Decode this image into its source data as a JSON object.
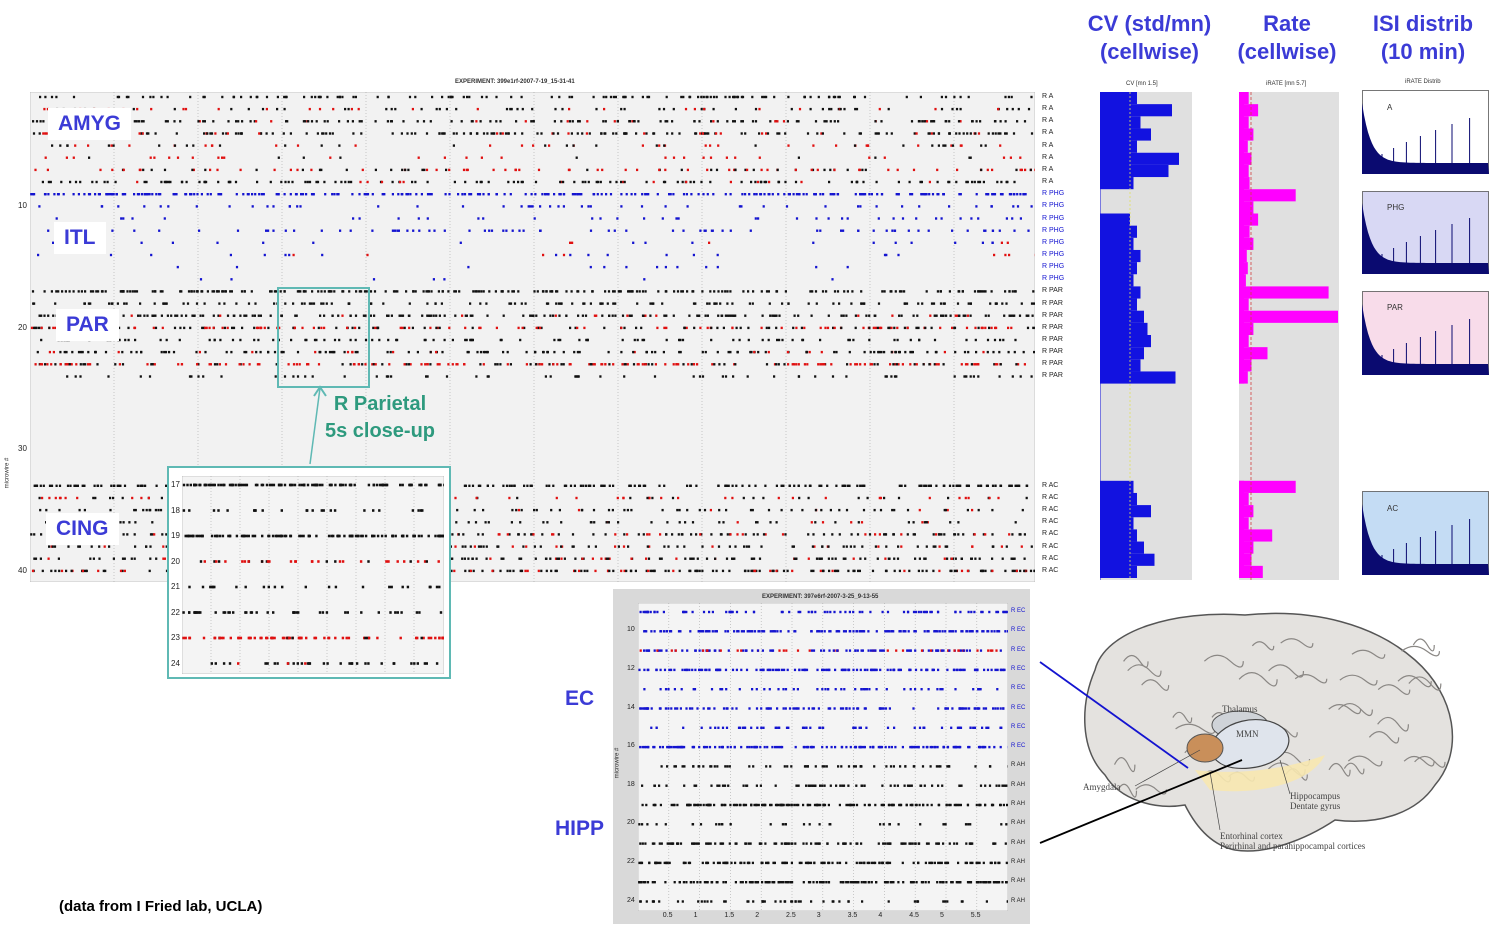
{
  "headers": {
    "cv": "CV (std/mn)\n(cellwise)",
    "rate": "Rate\n(cellwise)",
    "isi": "ISI distrib\n(10 min)"
  },
  "raster_main": {
    "title": "EXPERIMENT: 399e1rf-2007-7-19_15-31-41",
    "ylabel": "microwire #",
    "yticks": [
      "10",
      "20",
      "30",
      "40"
    ],
    "channel_labels": [
      "R A",
      "R A",
      "R A",
      "R A",
      "R A",
      "R A",
      "R A",
      "R A",
      "R PHG",
      "R PHG",
      "R PHG",
      "R PHG",
      "R PHG",
      "R PHG",
      "R PHG",
      "R PHG",
      "R PAR",
      "R PAR",
      "R PAR",
      "R PAR",
      "R PAR",
      "R PAR",
      "R PAR",
      "R PAR",
      "R AC",
      "R AC",
      "R AC",
      "R AC",
      "R AC",
      "R AC",
      "R AC",
      "R AC"
    ],
    "regions": [
      "AMYG",
      "ITL",
      "PAR",
      "CING"
    ]
  },
  "closeup": {
    "callout": "R Parietal\n5s close-up",
    "rows": [
      "17",
      "18",
      "19",
      "20",
      "21",
      "22",
      "23",
      "24"
    ]
  },
  "cv_panel": {
    "title": "CV [mn 1.5]"
  },
  "rate_panel": {
    "title": "iRATE [mn 5.7]"
  },
  "isi_panel": {
    "title": "iRATE Distrib",
    "boxes": [
      "A",
      "PHG",
      "PAR",
      "AC"
    ]
  },
  "raster_hipp": {
    "title": "EXPERIMENT: 397e6rf-2007-3-25_9-13-55",
    "ylabel": "microwire #",
    "yticks": [
      "10",
      "12",
      "14",
      "16",
      "18",
      "20",
      "22",
      "24"
    ],
    "channel_labels": [
      "R EC",
      "R EC",
      "R EC",
      "R EC",
      "R EC",
      "R EC",
      "R EC",
      "R EC",
      "R AH",
      "R AH",
      "R AH",
      "R AH",
      "R AH",
      "R AH",
      "R AH",
      "R AH"
    ],
    "xticks": [
      "0.5",
      "1",
      "1.5",
      "2",
      "2.5",
      "3",
      "3.5",
      "4",
      "4.5",
      "5",
      "5.5"
    ],
    "regions": [
      "EC",
      "HIPP"
    ]
  },
  "brain": {
    "labels": [
      "Thalamus",
      "MMN",
      "Amygdala",
      "Hippocampus\nDentate gyrus",
      "Entorhinal cortex\nPerirhinal and parahippocampal cortices"
    ]
  },
  "credit": "(data from I Fried lab, UCLA)",
  "colors": {
    "blue_label": "#3b3bd6",
    "teal": "#2e9a7e",
    "spike_red": "#e01010",
    "spike_blue": "#1414d0",
    "magenta": "#ff00ff"
  }
}
